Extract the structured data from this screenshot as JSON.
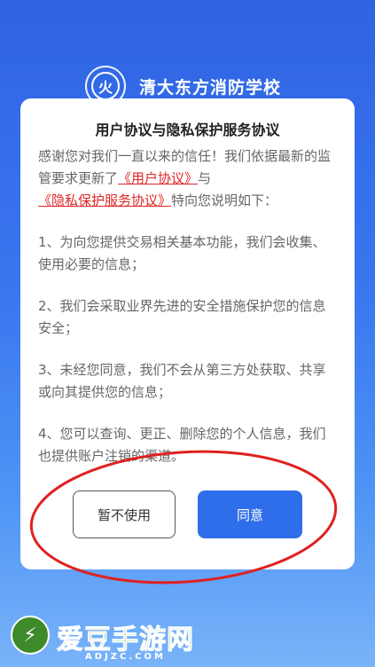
{
  "header": {
    "school_name": "清大东方消防学校",
    "logo_glyph": "火"
  },
  "dialog": {
    "title": "用户协议与隐私保护服务协议",
    "intro_prefix": "感谢您对我们一直以来的信任！我们依据最新的监管要求更新了",
    "user_agreement_link": "《用户协议》",
    "and_text": "与",
    "privacy_link": "《隐私保护服务协议》",
    "intro_suffix": "特向您说明如下：",
    "items": [
      "1、为向您提供交易相关基本功能，我们会收集、使用必要的信息；",
      "2、我们会采取业界先进的安全措施保护您的信息安全；",
      "3、未经您同意，我们不会从第三方处获取、共享或向其提供您的信息；",
      "4、您可以查询、更正、删除您的个人信息，我们也提供账户注销的渠道。"
    ],
    "decline_label": "暂不使用",
    "agree_label": "同意"
  },
  "watermark": {
    "text": "爱豆手游网",
    "sub": "ADJZC.COM"
  },
  "colors": {
    "accent": "#2f6eea",
    "link": "#e02626",
    "annotation": "#e02020",
    "background": "#3a78ef"
  }
}
